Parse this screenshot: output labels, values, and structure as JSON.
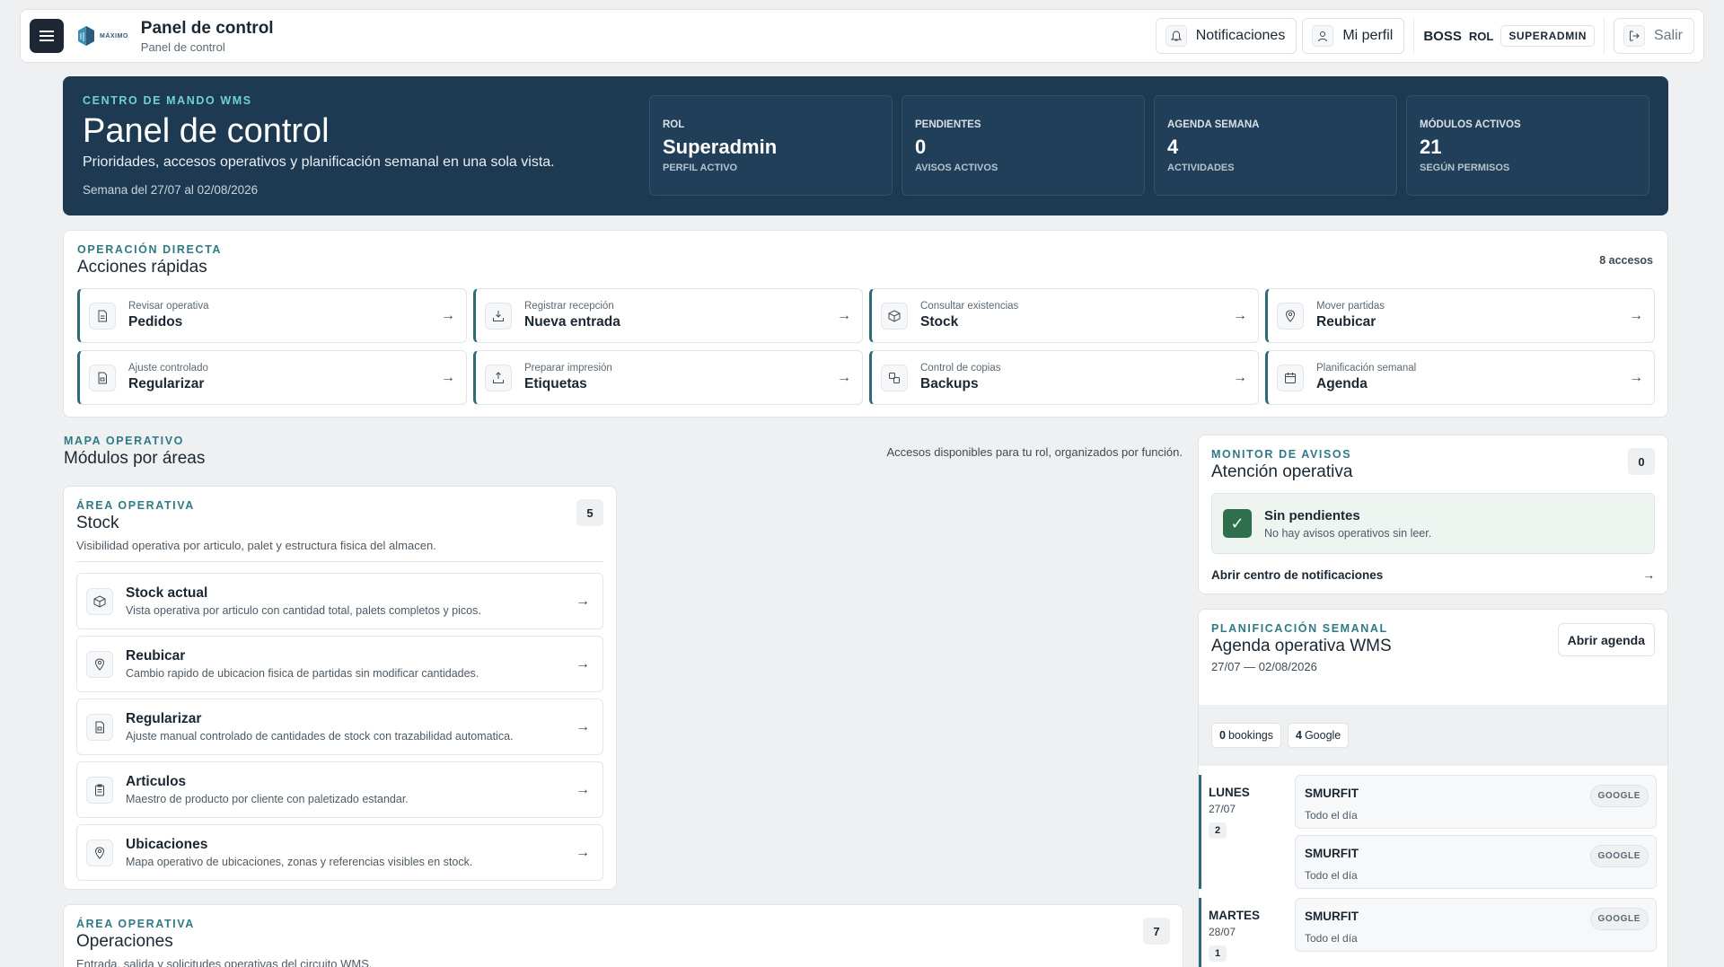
{
  "header": {
    "logo_text": "MÁXIMO",
    "title": "Panel de control",
    "subtitle": "Panel de control",
    "notifications_label": "Notificaciones",
    "profile_label": "Mi perfil",
    "user": "BOSS",
    "role_label": "ROL",
    "role_value": "SUPERADMIN",
    "logout_label": "Salir"
  },
  "hero": {
    "eyebrow": "CENTRO DE MANDO WMS",
    "title": "Panel de control",
    "description": "Prioridades, accesos operativos y planificación semanal en una sola vista.",
    "week": "Semana del 27/07 al 02/08/2026",
    "stats": [
      {
        "label": "ROL",
        "value": "Superadmin",
        "sub": "PERFIL ACTIVO"
      },
      {
        "label": "PENDIENTES",
        "value": "0",
        "sub": "AVISOS ACTIVOS"
      },
      {
        "label": "AGENDA SEMANA",
        "value": "4",
        "sub": "ACTIVIDADES"
      },
      {
        "label": "MÓDULOS ACTIVOS",
        "value": "21",
        "sub": "SEGÚN PERMISOS"
      }
    ]
  },
  "quick": {
    "eyebrow": "OPERACIÓN DIRECTA",
    "title": "Acciones rápidas",
    "count": "8 accesos",
    "items": [
      {
        "sub": "Revisar operativa",
        "label": "Pedidos",
        "icon": "document-icon"
      },
      {
        "sub": "Registrar recepción",
        "label": "Nueva entrada",
        "icon": "inbox-icon"
      },
      {
        "sub": "Consultar existencias",
        "label": "Stock",
        "icon": "box-icon"
      },
      {
        "sub": "Mover partidas",
        "label": "Reubicar",
        "icon": "pin-icon"
      },
      {
        "sub": "Ajuste controlado",
        "label": "Regularizar",
        "icon": "adjust-icon"
      },
      {
        "sub": "Preparar impresión",
        "label": "Etiquetas",
        "icon": "print-icon"
      },
      {
        "sub": "Control de copias",
        "label": "Backups",
        "icon": "backup-icon"
      },
      {
        "sub": "Planificación semanal",
        "label": "Agenda",
        "icon": "calendar-icon"
      }
    ]
  },
  "map": {
    "eyebrow": "MAPA OPERATIVO",
    "title": "Módulos por áreas",
    "note": "Accesos disponibles para tu rol, organizados por función."
  },
  "stock_area": {
    "eyebrow": "ÁREA OPERATIVA",
    "title": "Stock",
    "description": "Visibilidad operativa por articulo, palet y estructura fisica del almacen.",
    "count": "5",
    "modules": [
      {
        "title": "Stock actual",
        "desc": "Vista operativa por articulo con cantidad total, palets completos y picos."
      },
      {
        "title": "Reubicar",
        "desc": "Cambio rapido de ubicacion fisica de partidas sin modificar cantidades."
      },
      {
        "title": "Regularizar",
        "desc": "Ajuste manual controlado de cantidades de stock con trazabilidad automatica."
      },
      {
        "title": "Articulos",
        "desc": "Maestro de producto por cliente con paletizado estandar."
      },
      {
        "title": "Ubicaciones",
        "desc": "Mapa operativo de ubicaciones, zonas y referencias visibles en stock."
      }
    ]
  },
  "ops_area": {
    "eyebrow": "ÁREA OPERATIVA",
    "title": "Operaciones",
    "description": "Entrada, salida y solicitudes operativas del circuito WMS.",
    "count": "7"
  },
  "avisos": {
    "eyebrow": "MONITOR DE AVISOS",
    "title": "Atención operativa",
    "count": "0",
    "ok_title": "Sin pendientes",
    "ok_sub": "No hay avisos operativos sin leer.",
    "link": "Abrir centro de notificaciones"
  },
  "agenda": {
    "eyebrow": "PLANIFICACIÓN SEMANAL",
    "title": "Agenda operativa WMS",
    "range": "27/07 — 02/08/2026",
    "open_label": "Abrir agenda",
    "bookings_count": "0",
    "bookings_label": "bookings",
    "google_count": "4",
    "google_label": "Google",
    "days": [
      {
        "name": "LUNES",
        "date": "27/07",
        "count": "2",
        "events": [
          {
            "title": "SMURFIT",
            "time": "Todo el día",
            "badge": "GOOGLE"
          },
          {
            "title": "SMURFIT",
            "time": "Todo el día",
            "badge": "GOOGLE"
          }
        ]
      },
      {
        "name": "MARTES",
        "date": "28/07",
        "count": "1",
        "events": [
          {
            "title": "SMURFIT",
            "time": "Todo el día",
            "badge": "GOOGLE"
          }
        ]
      }
    ]
  },
  "colors": {
    "hero_bg": "#1e3a52",
    "accent": "#2d6c76",
    "success": "#2f6f4e"
  }
}
